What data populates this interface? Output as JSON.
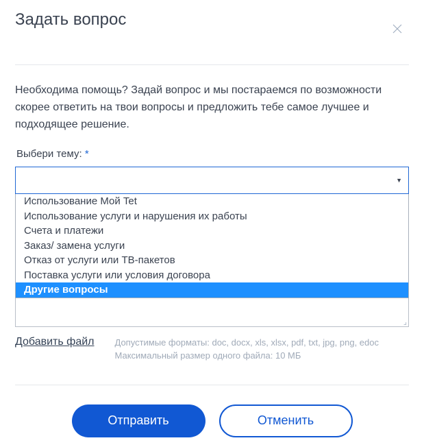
{
  "title": "Задать вопрос",
  "description": "Необходима помощь? Задай вопрос и мы постараемся по возможности скорее ответить на твои вопросы и предложить тебе самое лучшее и подходящее решение.",
  "topic": {
    "label": "Выбери тему:",
    "required_marker": "*",
    "options": [
      "Использование Мой Tet",
      "Использование услуги и нарушения их работы",
      "Счета и платежи",
      "Заказ/ замена услуги",
      "Отказ от услуги или ТВ-пакетов",
      "Поставка услуги или условия договора",
      "Другие вопросы"
    ],
    "selected_index": 6
  },
  "file": {
    "add_label": "Добавить файл",
    "hint_formats": "Допустимые форматы: doc, docx, xls, xlsx, pdf, txt, jpg, png, edoc",
    "hint_size": "Максимальный размер одного файла: 10 МБ"
  },
  "buttons": {
    "submit": "Отправить",
    "cancel": "Отменить"
  }
}
